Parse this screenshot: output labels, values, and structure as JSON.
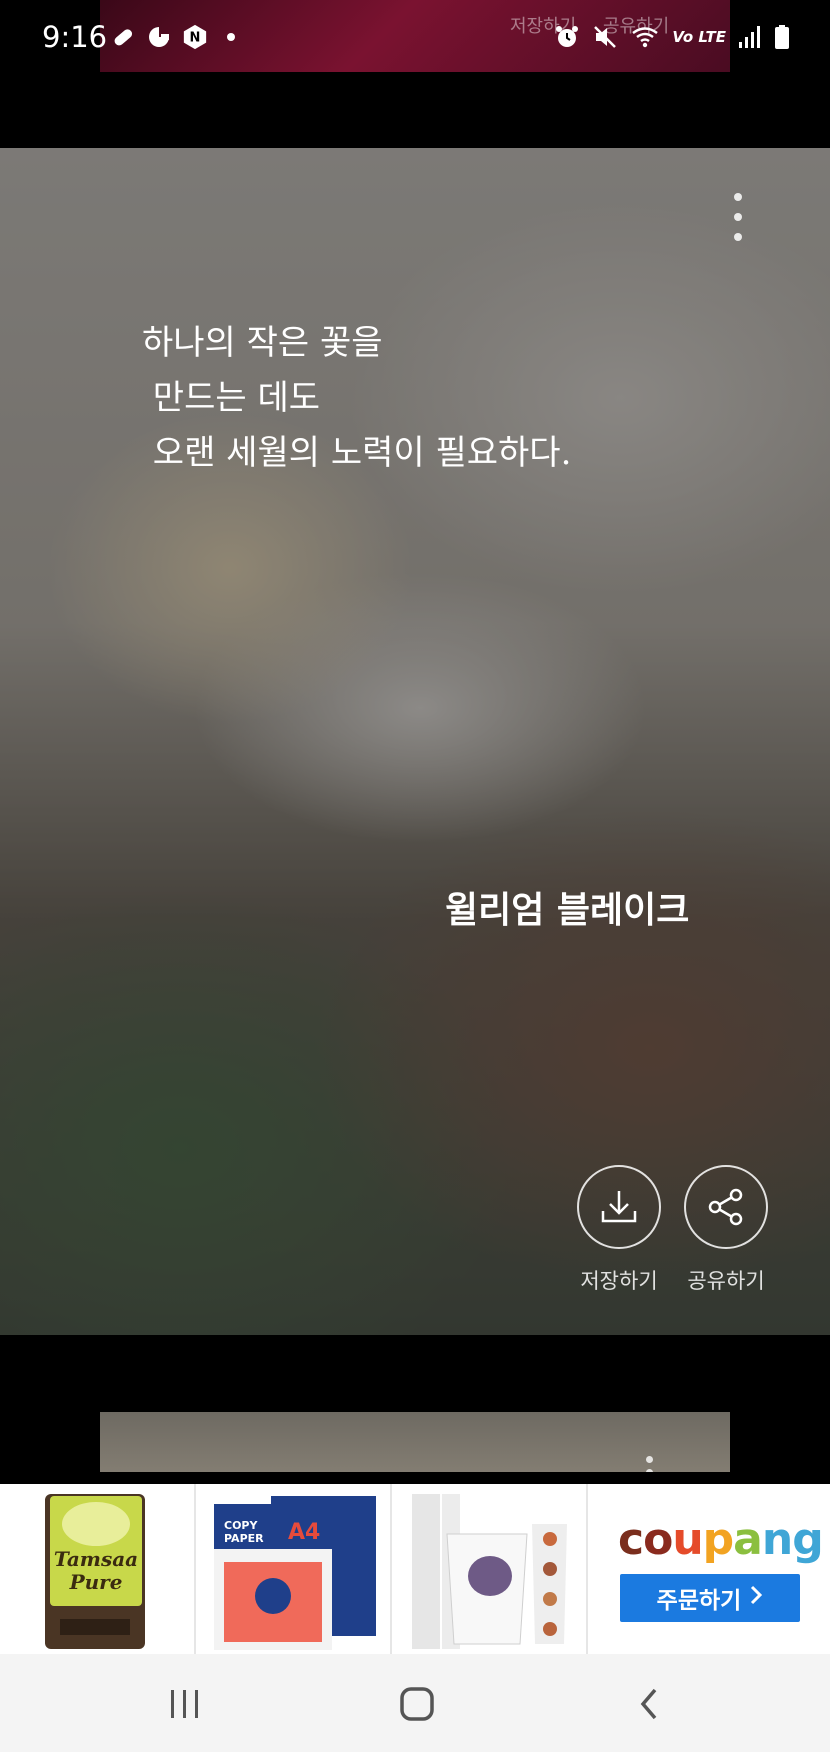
{
  "status_bar": {
    "time": "9:16",
    "network_label": "Vo LTE"
  },
  "peek_prev": {
    "save_label": "저장하기",
    "share_label": "공유하기"
  },
  "quote_card": {
    "quote_lines": [
      "하나의 작은 꽃을",
      " 만드는 데도",
      " 오랜 세월의 노력이 필요하다."
    ],
    "author": "윌리엄 블레이크",
    "save_label": "저장하기",
    "share_label": "공유하기"
  },
  "ad_banner": {
    "brand": "coupang",
    "order_label": "주문하기",
    "products": [
      "Tamsaa Pure tissue",
      "Tamsaa A4 copy paper",
      "Tamsaa paper cups"
    ]
  },
  "icons": {
    "notifications": [
      "bandage-icon",
      "pac-icon",
      "n-app-icon",
      "dot-icon"
    ],
    "system": [
      "alarm-icon",
      "mute-icon",
      "wifi-icon",
      "volte-icon",
      "signal-icon",
      "battery-icon"
    ],
    "nav": [
      "recents-icon",
      "home-icon",
      "back-icon"
    ]
  },
  "colors": {
    "order_button": "#1b7ae0",
    "nav_bar": "#f4f4f4"
  }
}
